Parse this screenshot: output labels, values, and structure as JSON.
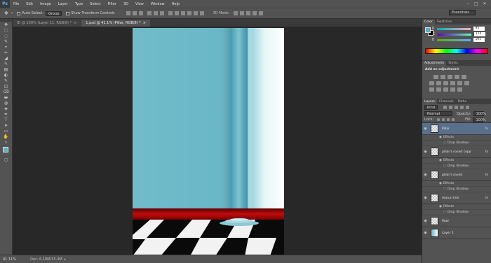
{
  "app": {
    "logo": "Ps"
  },
  "menu": {
    "items": [
      "File",
      "Edit",
      "Image",
      "Layer",
      "Type",
      "Select",
      "Filter",
      "3D",
      "View",
      "Window",
      "Help"
    ]
  },
  "window_controls": [
    "–",
    "□",
    "✕"
  ],
  "options": {
    "tool_glyph": "✥",
    "auto_select_label": "Auto-Select:",
    "auto_select_value": "Group",
    "transform_label": "Show Transform Controls",
    "mode_3d_label": "3D Mode:",
    "workspace": "Essentials"
  },
  "tabs": [
    {
      "label": "ID @ 100% (Layer 11, RGB/8) *",
      "close": "×"
    },
    {
      "label": "1.psd @ 41.1% (Pillar, RGB/8) *",
      "close": "×"
    }
  ],
  "tools": [
    "✥",
    "⬚",
    "◌",
    "✎",
    "⌖",
    "✂",
    "◢",
    "✎",
    "▤",
    "◐",
    "✎",
    "◫",
    "⌫",
    "▬",
    "◍",
    "◈",
    "✒",
    "T",
    "➤",
    "▭",
    "✋",
    "⌕"
  ],
  "status": {
    "zoom": "41.11%",
    "doc": "Doc: 6.18M/15.4M"
  },
  "color_panel": {
    "tabs": [
      "Color",
      "Swatches"
    ],
    "channels": [
      {
        "label": "R",
        "value": "95"
      },
      {
        "label": "G",
        "value": "174"
      },
      {
        "label": "B",
        "value": "191"
      }
    ],
    "fg_color": "#5faebf",
    "bg_color": "#000000"
  },
  "adjustments_panel": {
    "tabs": [
      "Adjustments",
      "Styles"
    ],
    "title": "Add an adjustment"
  },
  "layers_panel": {
    "tabs": [
      "Layers",
      "Channels",
      "Paths"
    ],
    "kind_filter": "Kind",
    "blend_mode": "Normal",
    "opacity_label": "Opacity:",
    "opacity": "100%",
    "lock_label": "Lock:",
    "fill_label": "Fill:",
    "fill": "100%",
    "layers": [
      {
        "name": "Pillar",
        "fx": "fx",
        "selected": true,
        "subs": [
          "Effects",
          "Drop Shadow"
        ]
      },
      {
        "name": "pillar's round copy",
        "fx": "fx",
        "selected": false,
        "subs": [
          "Effects",
          "Drop Shadow"
        ]
      },
      {
        "name": "pillar's round",
        "fx": "fx",
        "selected": false,
        "subs": [
          "Effects",
          "Drop Shadow"
        ]
      },
      {
        "name": "marun line",
        "fx": "fx",
        "selected": false,
        "subs": [
          "Effects",
          "Drop Shadow"
        ]
      },
      {
        "name": "floor",
        "fx": "",
        "selected": false,
        "subs": []
      },
      {
        "name": "Layer 1",
        "fx": "",
        "selected": false,
        "subs": []
      }
    ]
  }
}
